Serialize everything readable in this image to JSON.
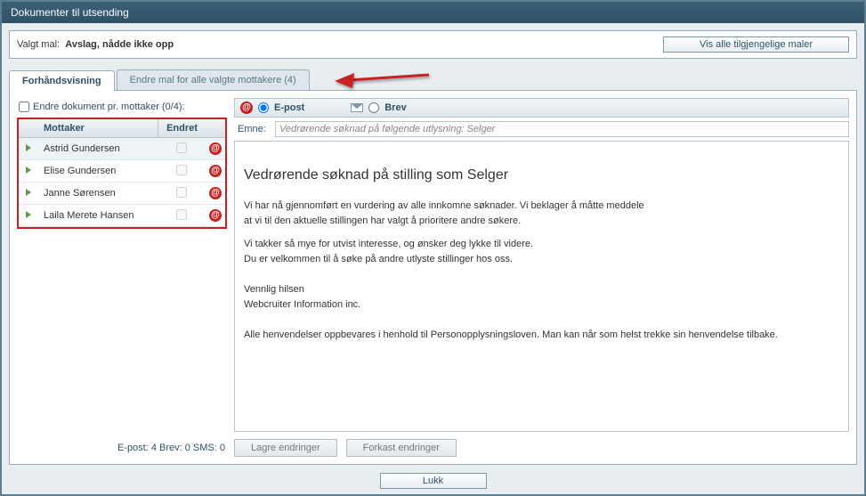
{
  "window": {
    "title": "Dokumenter til utsending"
  },
  "templateBar": {
    "prefix": "Valgt mal:",
    "name": "Avslag, nådde ikke opp",
    "showAllBtn": "Vis alle tilgjengelige maler"
  },
  "tabs": {
    "preview": "Forhåndsvisning",
    "editAll": "Endre mal for alle valgte mottakere (4)"
  },
  "leftPanel": {
    "editPerRecipient": "Endre dokument pr. mottaker (0/4):",
    "headers": {
      "recipient": "Mottaker",
      "changed": "Endret"
    },
    "recipients": [
      {
        "name": "Astrid Gundersen",
        "changed": false,
        "selected": true
      },
      {
        "name": "Elise Gundersen",
        "changed": false,
        "selected": false
      },
      {
        "name": "Janne Sørensen",
        "changed": false,
        "selected": false
      },
      {
        "name": "Laila Merete Hansen",
        "changed": false,
        "selected": false
      }
    ],
    "stats": "E-post: 4    Brev: 0    SMS: 0"
  },
  "sendType": {
    "email": "E-post",
    "letter": "Brev"
  },
  "subject": {
    "label": "Emne:",
    "value": "Vedrørende søknad på følgende utlysning: Selger"
  },
  "body": {
    "heading": "Vedrørende søknad på stilling som Selger",
    "p1": "Vi har nå gjennomført en vurdering av alle innkomne søknader. Vi beklager å måtte meddele",
    "p2": "at vi til den aktuelle stillingen har valgt å prioritere andre søkere.",
    "p3": "Vi takker så mye for utvist interesse, og ønsker deg lykke til videre.",
    "p4": "Du er velkommen til å søke på andre utlyste stillinger hos oss.",
    "p5": "Vennlig hilsen",
    "p6": "Webcruiter Information inc.",
    "p7": "Alle henvendelser oppbevares i henhold til Personopplysningsloven. Man kan når som helst trekke sin henvendelse tilbake."
  },
  "buttons": {
    "save": "Lagre endringer",
    "discard": "Forkast endringer",
    "close": "Lukk"
  }
}
